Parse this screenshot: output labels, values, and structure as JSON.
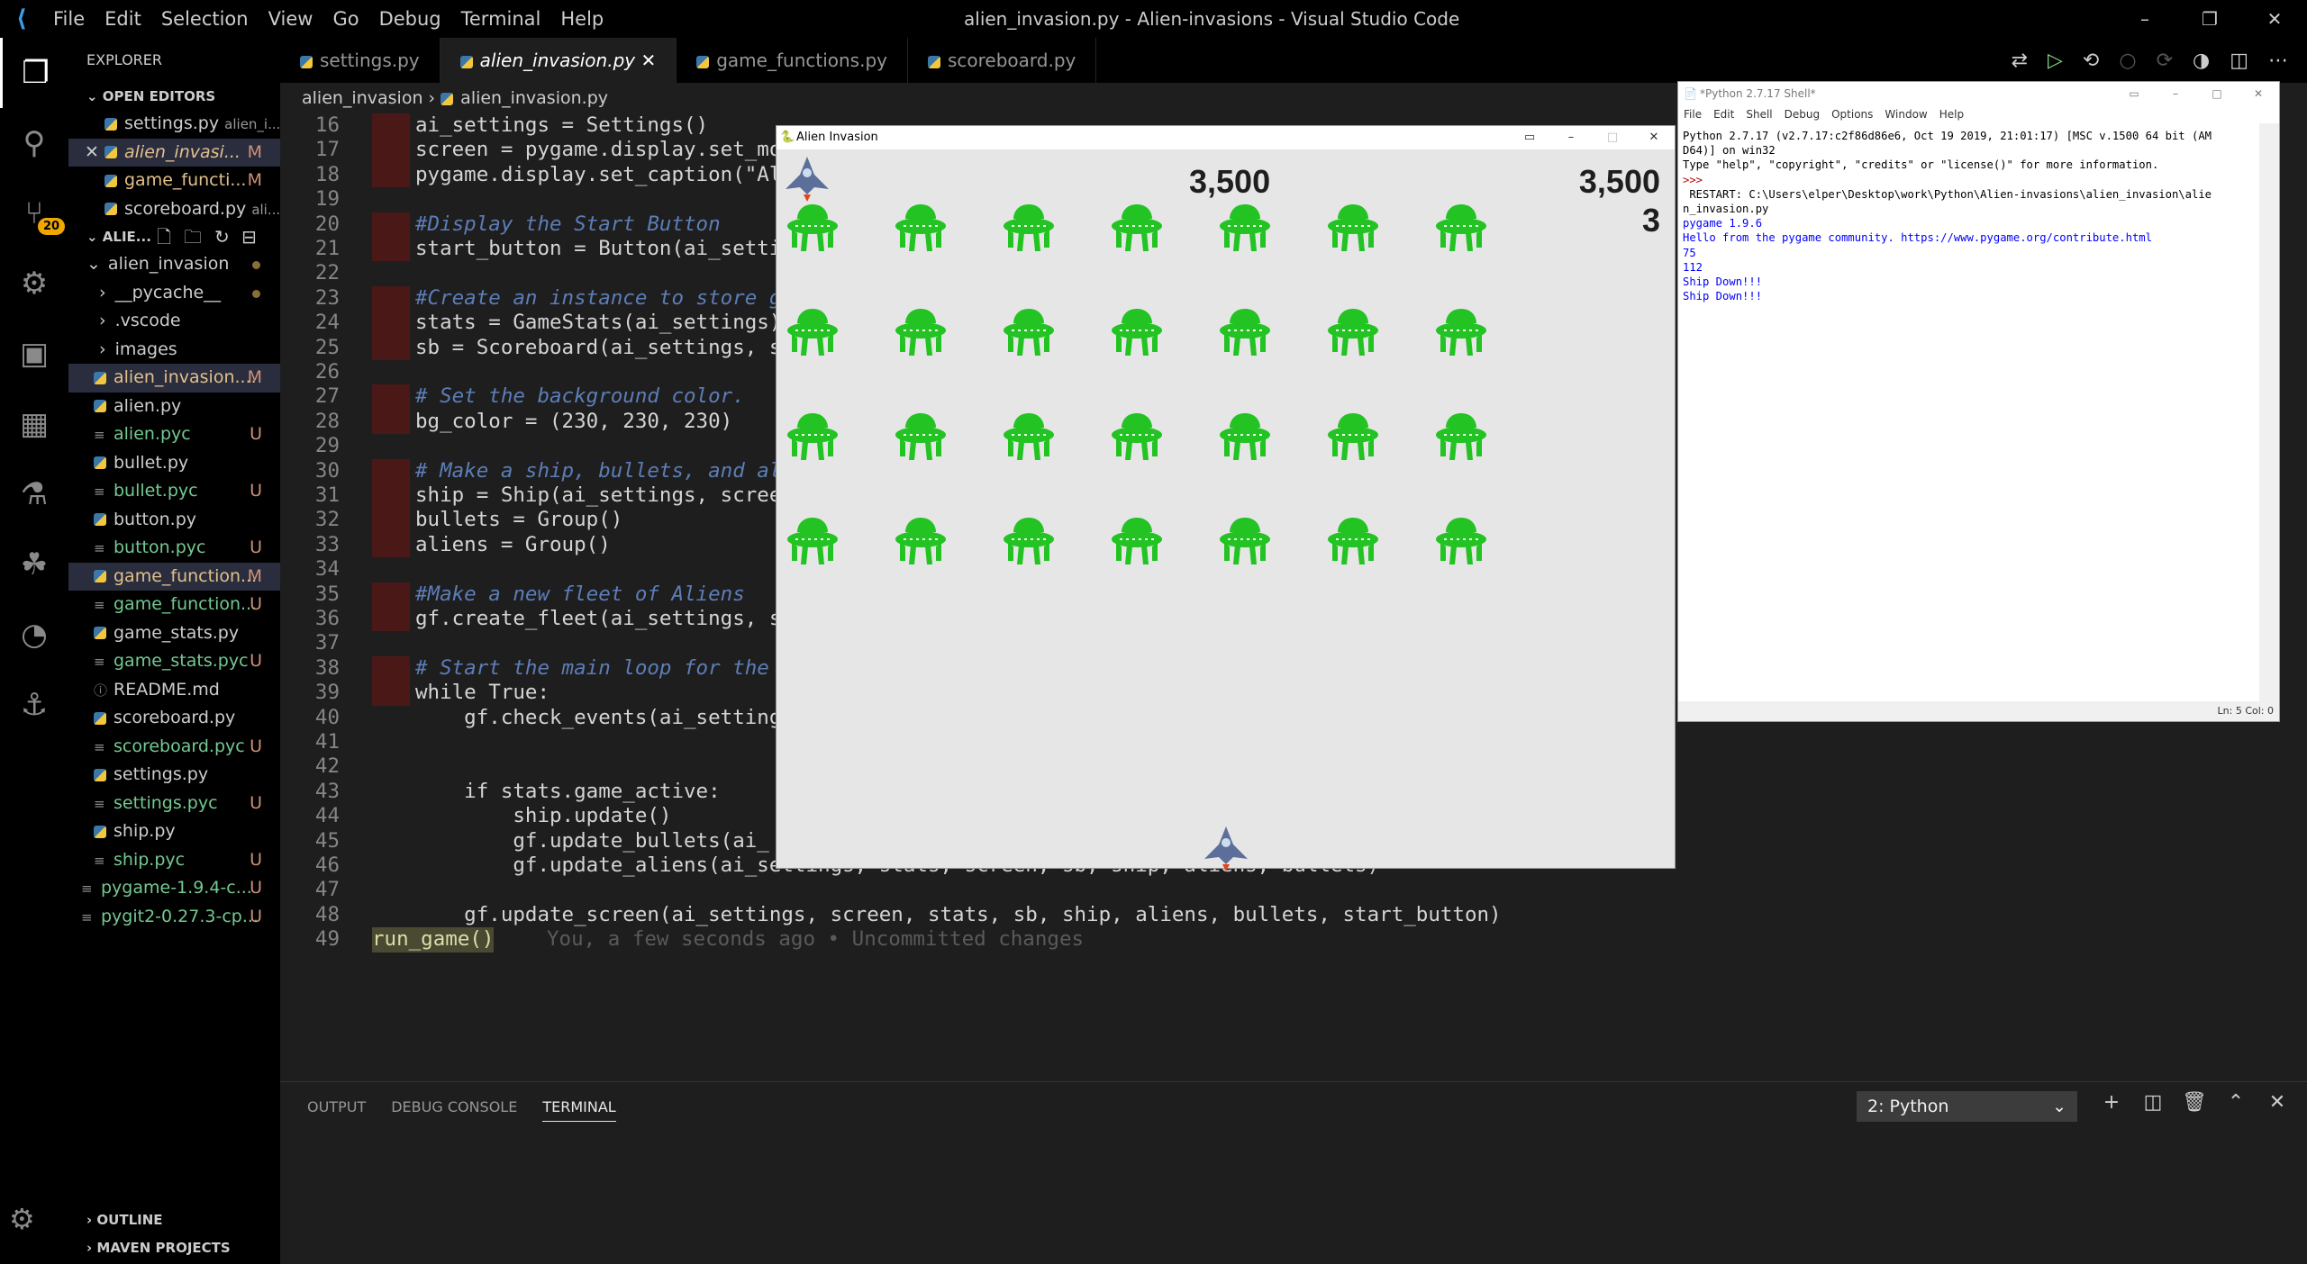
{
  "titlebar": {
    "menu": [
      "File",
      "Edit",
      "Selection",
      "View",
      "Go",
      "Debug",
      "Terminal",
      "Help"
    ],
    "title": "alien_invasion.py - Alien-invasions - Visual Studio Code"
  },
  "activity": {
    "badge": "20"
  },
  "explorer": {
    "header": "EXPLORER",
    "open_editors": "OPEN EDITORS",
    "project": "ALIE...",
    "open_files": [
      {
        "name": "settings.py",
        "desc": "alien_i...",
        "status": ""
      },
      {
        "name": "alien_invasi...",
        "desc": "",
        "status": "M"
      },
      {
        "name": "game_functi...",
        "desc": "",
        "status": "M"
      },
      {
        "name": "scoreboard.py",
        "desc": "ali...",
        "status": ""
      }
    ],
    "tree": [
      {
        "name": "alien_invasion",
        "type": "folder",
        "status": ""
      },
      {
        "name": "__pycache__",
        "type": "folder",
        "status": ""
      },
      {
        "name": ".vscode",
        "type": "folder",
        "status": ""
      },
      {
        "name": "images",
        "type": "folder",
        "status": ""
      },
      {
        "name": "alien_invasion....",
        "type": "py",
        "status": "M"
      },
      {
        "name": "alien.py",
        "type": "py",
        "status": ""
      },
      {
        "name": "alien.pyc",
        "type": "txt",
        "status": "U"
      },
      {
        "name": "bullet.py",
        "type": "py",
        "status": ""
      },
      {
        "name": "bullet.pyc",
        "type": "txt",
        "status": "U"
      },
      {
        "name": "button.py",
        "type": "py",
        "status": ""
      },
      {
        "name": "button.pyc",
        "type": "txt",
        "status": "U"
      },
      {
        "name": "game_function...",
        "type": "py",
        "status": "M"
      },
      {
        "name": "game_function...",
        "type": "txt",
        "status": "U"
      },
      {
        "name": "game_stats.py",
        "type": "py",
        "status": ""
      },
      {
        "name": "game_stats.pyc",
        "type": "txt",
        "status": "U"
      },
      {
        "name": "README.md",
        "type": "info",
        "status": ""
      },
      {
        "name": "scoreboard.py",
        "type": "py",
        "status": ""
      },
      {
        "name": "scoreboard.pyc",
        "type": "txt",
        "status": "U"
      },
      {
        "name": "settings.py",
        "type": "py",
        "status": ""
      },
      {
        "name": "settings.pyc",
        "type": "txt",
        "status": "U"
      },
      {
        "name": "ship.py",
        "type": "py",
        "status": ""
      },
      {
        "name": "ship.pyc",
        "type": "txt",
        "status": "U"
      },
      {
        "name": "pygame-1.9.4-c...",
        "type": "txt",
        "status": "U"
      },
      {
        "name": "pygit2-0.27.3-cp...",
        "type": "txt",
        "status": "U"
      }
    ],
    "outline": "OUTLINE",
    "maven": "MAVEN PROJECTS"
  },
  "tabs": [
    {
      "label": "settings.py"
    },
    {
      "label": "alien_invasion.py"
    },
    {
      "label": "game_functions.py"
    },
    {
      "label": "scoreboard.py"
    }
  ],
  "breadcrumb": {
    "folder": "alien_invasion",
    "file": "alien_invasion.py"
  },
  "code": [
    {
      "n": "16",
      "t": "ai_settings = Settings()"
    },
    {
      "n": "17",
      "t": "screen = pygame.display.set_mode("
    },
    {
      "n": "18",
      "t": "pygame.display.set_caption(\"Alien"
    },
    {
      "n": "19",
      "t": ""
    },
    {
      "n": "20",
      "t": "#Display the Start Button"
    },
    {
      "n": "21",
      "t": "start_button = Button(ai_settings"
    },
    {
      "n": "22",
      "t": ""
    },
    {
      "n": "23",
      "t": "#Create an instance to store game"
    },
    {
      "n": "24",
      "t": "stats = GameStats(ai_settings)"
    },
    {
      "n": "25",
      "t": "sb = Scoreboard(ai_settings, scre"
    },
    {
      "n": "26",
      "t": ""
    },
    {
      "n": "27",
      "t": "# Set the background color."
    },
    {
      "n": "28",
      "t": "bg_color = (230, 230, 230)"
    },
    {
      "n": "29",
      "t": ""
    },
    {
      "n": "30",
      "t": "# Make a ship, bullets, and alien"
    },
    {
      "n": "31",
      "t": "ship = Ship(ai_settings, screen)"
    },
    {
      "n": "32",
      "t": "bullets = Group()"
    },
    {
      "n": "33",
      "t": "aliens = Group()"
    },
    {
      "n": "34",
      "t": ""
    },
    {
      "n": "35",
      "t": "#Make a new fleet of Aliens"
    },
    {
      "n": "36",
      "t": "gf.create_fleet(ai_settings, scre"
    },
    {
      "n": "37",
      "t": ""
    },
    {
      "n": "38",
      "t": "# Start the main loop for the gam"
    },
    {
      "n": "39",
      "t": "while True:"
    },
    {
      "n": "40",
      "t": "    gf.check_events(ai_settings,"
    },
    {
      "n": "41",
      "t": ""
    },
    {
      "n": "42",
      "t": ""
    },
    {
      "n": "43",
      "t": "    if stats.game_active:"
    },
    {
      "n": "44",
      "t": "        ship.update()"
    },
    {
      "n": "45",
      "t": "        gf.update_bullets(ai_"
    },
    {
      "n": "46",
      "t": "        gf.update_aliens(ai_settings, stats, screen, sb, ship, aliens, bullets)"
    },
    {
      "n": "47",
      "t": ""
    },
    {
      "n": "48",
      "t": "    gf.update_screen(ai_settings, screen, stats, sb, ship, aliens, bullets, start_button)"
    },
    {
      "n": "49",
      "t": "run_game()"
    }
  ],
  "blame": "You, a few seconds ago • Uncommitted changes",
  "panel": {
    "tabs": [
      "OUTPUT",
      "DEBUG CONSOLE",
      "TERMINAL"
    ],
    "terminal_select": "2: Python"
  },
  "game": {
    "title": "Alien Invasion",
    "score": "3,500",
    "high_score": "3,500",
    "level": "3"
  },
  "shell": {
    "title": "*Python 2.7.17 Shell*",
    "menu": [
      "File",
      "Edit",
      "Shell",
      "Debug",
      "Options",
      "Window",
      "Help"
    ],
    "lines": [
      {
        "t": "Python 2.7.17 (v2.7.17:c2f86d86e6, Oct 19 2019, 21:01:17) [MSC v.1500 64 bit (AM",
        "c": "k"
      },
      {
        "t": "D64)] on win32",
        "c": "k"
      },
      {
        "t": "Type \"help\", \"copyright\", \"credits\" or \"license()\" for more information.",
        "c": "k"
      },
      {
        "t": ">>> ",
        "c": "r"
      },
      {
        "t": " RESTART: C:\\Users\\elper\\Desktop\\work\\Python\\Alien-invasions\\alien_invasion\\alie",
        "c": "k"
      },
      {
        "t": "n_invasion.py",
        "c": "k"
      },
      {
        "t": "pygame 1.9.6",
        "c": "b"
      },
      {
        "t": "Hello from the pygame community. https://www.pygame.org/contribute.html",
        "c": "b"
      },
      {
        "t": "75",
        "c": "b"
      },
      {
        "t": "112",
        "c": "b"
      },
      {
        "t": "Ship Down!!!",
        "c": "b"
      },
      {
        "t": "Ship Down!!!",
        "c": "b"
      }
    ],
    "status": "Ln: 5   Col: 0"
  },
  "colors": {
    "alien": "#22c322",
    "accent": "#007acc",
    "modified": "#e2c08d",
    "untracked": "#73c991"
  }
}
